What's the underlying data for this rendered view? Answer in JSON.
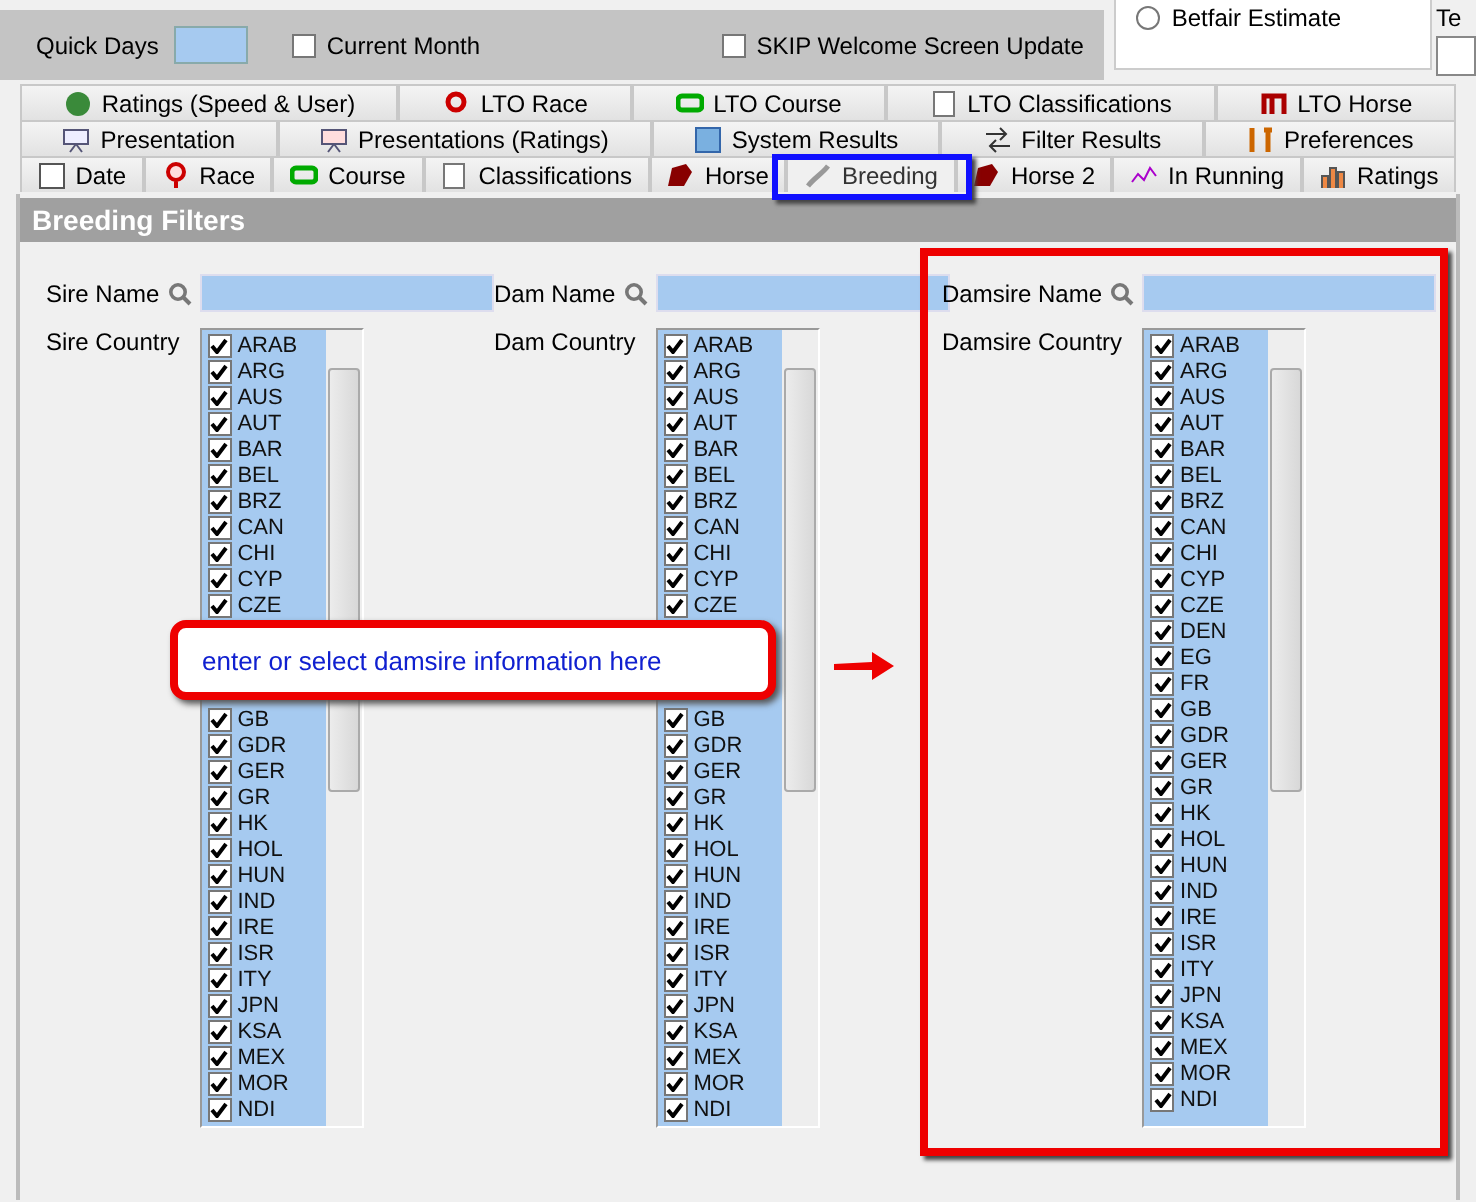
{
  "top": {
    "quick_days_label": "Quick Days",
    "checkboxes": [
      {
        "label": "Current Month",
        "checked": false
      },
      {
        "label": "SKIP Welcome Screen Update",
        "checked": false
      }
    ],
    "radio": {
      "label": "Betfair Estimate",
      "selected": false
    },
    "cut_label": "Te"
  },
  "tab_rows": [
    [
      {
        "label": "Ratings (Speed & User)",
        "selected": false
      },
      {
        "label": "LTO Race",
        "selected": false
      },
      {
        "label": "LTO Course",
        "selected": false
      },
      {
        "label": "LTO Classifications",
        "selected": false
      },
      {
        "label": "LTO Horse",
        "selected": false
      }
    ],
    [
      {
        "label": "Presentation",
        "selected": false
      },
      {
        "label": "Presentations (Ratings)",
        "selected": false
      },
      {
        "label": "System Results",
        "selected": false
      },
      {
        "label": "Filter Results",
        "selected": false
      },
      {
        "label": "Preferences",
        "selected": false
      }
    ],
    [
      {
        "label": "Date",
        "selected": false
      },
      {
        "label": "Race",
        "selected": false
      },
      {
        "label": "Course",
        "selected": false
      },
      {
        "label": "Classifications",
        "selected": false
      },
      {
        "label": "Horse",
        "selected": false
      },
      {
        "label": "Breeding",
        "selected": true
      },
      {
        "label": "Horse 2",
        "selected": false
      },
      {
        "label": "In Running",
        "selected": false
      },
      {
        "label": "Ratings",
        "selected": false
      }
    ]
  ],
  "panel": {
    "title": "Breeding Filters",
    "columns": [
      {
        "name_label": "Sire Name",
        "country_label": "Sire Country",
        "items_top": [
          {
            "label": "ARAB",
            "checked": true
          },
          {
            "label": "ARG",
            "checked": true
          },
          {
            "label": "AUS",
            "checked": true
          },
          {
            "label": "AUT",
            "checked": true
          },
          {
            "label": "BAR",
            "checked": true
          },
          {
            "label": "BEL",
            "checked": true
          },
          {
            "label": "BRZ",
            "checked": true
          },
          {
            "label": "CAN",
            "checked": true
          },
          {
            "label": "CHI",
            "checked": true
          },
          {
            "label": "CYP",
            "checked": true
          },
          {
            "label": "CZE",
            "checked": true
          }
        ],
        "items_bottom": [
          {
            "label": "GB",
            "checked": true
          },
          {
            "label": "GDR",
            "checked": true
          },
          {
            "label": "GER",
            "checked": true
          },
          {
            "label": "GR",
            "checked": true
          },
          {
            "label": "HK",
            "checked": true
          },
          {
            "label": "HOL",
            "checked": true
          },
          {
            "label": "HUN",
            "checked": true
          },
          {
            "label": "IND",
            "checked": true
          },
          {
            "label": "IRE",
            "checked": true
          },
          {
            "label": "ISR",
            "checked": true
          },
          {
            "label": "ITY",
            "checked": true
          },
          {
            "label": "JPN",
            "checked": true
          },
          {
            "label": "KSA",
            "checked": true
          },
          {
            "label": "MEX",
            "checked": true
          },
          {
            "label": "MOR",
            "checked": true
          },
          {
            "label": "NDI",
            "checked": true
          }
        ]
      },
      {
        "name_label": "Dam Name",
        "country_label": "Dam Country",
        "items_top": [
          {
            "label": "ARAB",
            "checked": true
          },
          {
            "label": "ARG",
            "checked": true
          },
          {
            "label": "AUS",
            "checked": true
          },
          {
            "label": "AUT",
            "checked": true
          },
          {
            "label": "BAR",
            "checked": true
          },
          {
            "label": "BEL",
            "checked": true
          },
          {
            "label": "BRZ",
            "checked": true
          },
          {
            "label": "CAN",
            "checked": true
          },
          {
            "label": "CHI",
            "checked": true
          },
          {
            "label": "CYP",
            "checked": true
          },
          {
            "label": "CZE",
            "checked": true
          }
        ],
        "items_bottom": [
          {
            "label": "GB",
            "checked": true
          },
          {
            "label": "GDR",
            "checked": true
          },
          {
            "label": "GER",
            "checked": true
          },
          {
            "label": "GR",
            "checked": true
          },
          {
            "label": "HK",
            "checked": true
          },
          {
            "label": "HOL",
            "checked": true
          },
          {
            "label": "HUN",
            "checked": true
          },
          {
            "label": "IND",
            "checked": true
          },
          {
            "label": "IRE",
            "checked": true
          },
          {
            "label": "ISR",
            "checked": true
          },
          {
            "label": "ITY",
            "checked": true
          },
          {
            "label": "JPN",
            "checked": true
          },
          {
            "label": "KSA",
            "checked": true
          },
          {
            "label": "MEX",
            "checked": true
          },
          {
            "label": "MOR",
            "checked": true
          },
          {
            "label": "NDI",
            "checked": true
          }
        ]
      },
      {
        "name_label": "Damsire Name",
        "country_label": "Damsire Country",
        "items_top": [
          {
            "label": "ARAB",
            "checked": true
          },
          {
            "label": "ARG",
            "checked": true
          },
          {
            "label": "AUS",
            "checked": true
          },
          {
            "label": "AUT",
            "checked": true
          },
          {
            "label": "BAR",
            "checked": true
          },
          {
            "label": "BEL",
            "checked": true
          },
          {
            "label": "BRZ",
            "checked": true
          },
          {
            "label": "CAN",
            "checked": true
          },
          {
            "label": "CHI",
            "checked": true
          },
          {
            "label": "CYP",
            "checked": true
          },
          {
            "label": "CZE",
            "checked": true
          },
          {
            "label": "DEN",
            "checked": true
          },
          {
            "label": "EG",
            "checked": true
          },
          {
            "label": "FR",
            "checked": true
          },
          {
            "label": "GB",
            "checked": true
          },
          {
            "label": "GDR",
            "checked": true
          },
          {
            "label": "GER",
            "checked": true
          },
          {
            "label": "GR",
            "checked": true
          },
          {
            "label": "HK",
            "checked": true
          },
          {
            "label": "HOL",
            "checked": true
          },
          {
            "label": "HUN",
            "checked": true
          },
          {
            "label": "IND",
            "checked": true
          },
          {
            "label": "IRE",
            "checked": true
          },
          {
            "label": "ISR",
            "checked": true
          },
          {
            "label": "ITY",
            "checked": true
          },
          {
            "label": "JPN",
            "checked": true
          },
          {
            "label": "KSA",
            "checked": true
          },
          {
            "label": "MEX",
            "checked": true
          },
          {
            "label": "MOR",
            "checked": true
          },
          {
            "label": "NDI",
            "checked": true
          }
        ]
      }
    ]
  },
  "callout": {
    "text": "enter or select damsire information here"
  }
}
